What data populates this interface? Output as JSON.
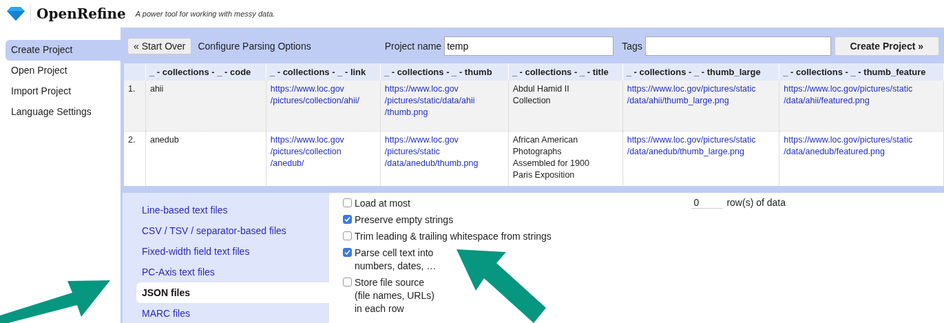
{
  "header": {
    "app_name": "OpenRefine",
    "tagline": "A power tool for working with messy data."
  },
  "sidebar": {
    "items": [
      {
        "label": "Create Project",
        "selected": true
      },
      {
        "label": "Open Project",
        "selected": false
      },
      {
        "label": "Import Project",
        "selected": false
      },
      {
        "label": "Language Settings",
        "selected": false
      }
    ]
  },
  "toolbar": {
    "start_over": "« Start Over",
    "title": "Configure Parsing Options",
    "project_name_label": "Project name",
    "project_name_value": "temp",
    "tags_label": "Tags",
    "create_button": "Create Project »"
  },
  "table": {
    "columns": [
      {
        "label": "_ - collections - _ - code",
        "kind": "text"
      },
      {
        "label": "_ - collections - _ - link",
        "kind": "link"
      },
      {
        "label": "_ - collections - _ - thumb",
        "kind": "link"
      },
      {
        "label": "_ - collections - _ - title",
        "kind": "text"
      },
      {
        "label": "_ - collections - _ - thumb_large",
        "kind": "link"
      },
      {
        "label": "_ - collections - _ - thumb_feature",
        "kind": "link"
      }
    ],
    "rows": [
      {
        "number": "1.",
        "cells": [
          "ahii",
          "https://www.loc.gov\n/pictures/collection/ahii/",
          "https://www.loc.gov\n/pictures/static/data/ahii\n/thumb.png",
          "Abdul Hamid II\nCollection",
          "https://www.loc.gov/pictures/static\n/data/ahii/thumb_large.png",
          "https://www.loc.gov/pictures/static\n/data/ahii/featured.png"
        ]
      },
      {
        "number": "2.",
        "cells": [
          "anedub",
          "https://www.loc.gov\n/pictures/collection\n/anedub/",
          "https://www.loc.gov\n/pictures/static\n/data/anedub/thumb.png",
          "African American\nPhotographs\nAssembled for 1900\nParis Exposition",
          "https://www.loc.gov/pictures/static\n/data/anedub/thumb_large.png",
          "https://www.loc.gov/pictures/static\n/data/anedub/featured.png"
        ]
      }
    ]
  },
  "formats": [
    {
      "label": "Line-based text files",
      "selected": false
    },
    {
      "label": "CSV / TSV / separator-based files",
      "selected": false
    },
    {
      "label": "Fixed-width field text files",
      "selected": false
    },
    {
      "label": "PC-Axis text files",
      "selected": false
    },
    {
      "label": "JSON files",
      "selected": true
    },
    {
      "label": "MARC files",
      "selected": false
    }
  ],
  "options": [
    {
      "label": "Load at most",
      "checked": false
    },
    {
      "label": "Preserve empty strings",
      "checked": true
    },
    {
      "label": "Trim leading & trailing whitespace from strings",
      "checked": false
    },
    {
      "label": "Parse cell text into\nnumbers, dates, …",
      "checked": true
    },
    {
      "label": "Store file source\n(file names, URLs)\nin each row",
      "checked": false
    }
  ],
  "load_limit": {
    "value": "0",
    "unit": "row(s) of data"
  }
}
